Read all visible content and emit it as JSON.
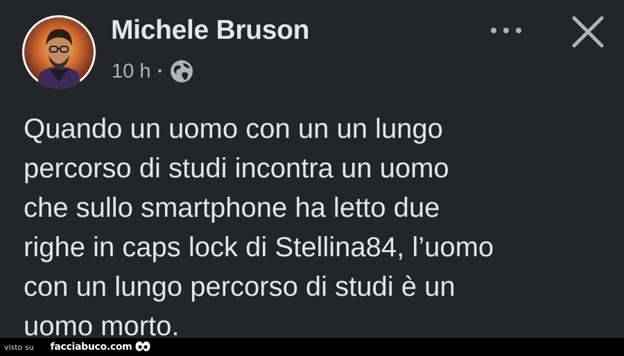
{
  "post": {
    "author": {
      "name": "Michele Bruson",
      "avatar_icon": "profile-photo"
    },
    "time": "10 h",
    "separator": "·",
    "audience_icon": "globe-icon",
    "more_icon": "more-options-icon",
    "close_icon": "close-icon",
    "text": "Quando un uomo con un un lungo\npercorso di studi incontra un uomo\nche sullo smartphone ha letto due\nrighe in caps lock di Stellina84, l’uomo\ncon un lungo percorso di studi è un\nuomo morto."
  },
  "footer": {
    "prefix": "visto su",
    "site": "facciabuco.com",
    "logo_icon": "eyes-icon"
  },
  "colors": {
    "background": "#242526",
    "text_primary": "#e4e6eb",
    "text_secondary": "#b0b3b8",
    "footer_background": "#000000"
  }
}
